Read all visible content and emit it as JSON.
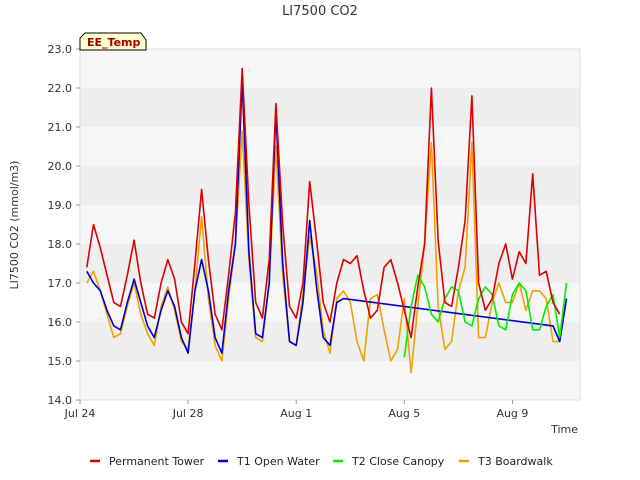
{
  "chart_data": {
    "type": "line",
    "title": "LI7500 CO2",
    "xlabel": "Time",
    "ylabel": "LI7500 CO2 (mmol/m3)",
    "badge": "EE_Temp",
    "xlim": [
      "2023-07-24",
      "2023-08-11T12:00"
    ],
    "ylim": [
      14.0,
      23.0
    ],
    "yticks": [
      "14.0",
      "15.0",
      "16.0",
      "17.0",
      "18.0",
      "19.0",
      "20.0",
      "21.0",
      "22.0",
      "23.0"
    ],
    "xticks": [
      {
        "date": "2023-07-24",
        "label": "Jul 24"
      },
      {
        "date": "2023-07-28",
        "label": "Jul 28"
      },
      {
        "date": "2023-08-01",
        "label": "Aug 1"
      },
      {
        "date": "2023-08-05",
        "label": "Aug 5"
      },
      {
        "date": "2023-08-09",
        "label": "Aug 9"
      }
    ],
    "grid": "horizontal bands",
    "legend_position": "bottom",
    "series": [
      {
        "name": "Permanent Tower",
        "color": "#dd0000",
        "points": [
          [
            "2023-07-24T06:00",
            17.4
          ],
          [
            "2023-07-24T12:00",
            18.5
          ],
          [
            "2023-07-24T18:00",
            17.9
          ],
          [
            "2023-07-25T00:00",
            17.2
          ],
          [
            "2023-07-25T06:00",
            16.5
          ],
          [
            "2023-07-25T12:00",
            16.4
          ],
          [
            "2023-07-25T18:00",
            17.2
          ],
          [
            "2023-07-26T00:00",
            18.1
          ],
          [
            "2023-07-26T06:00",
            17.0
          ],
          [
            "2023-07-26T12:00",
            16.2
          ],
          [
            "2023-07-26T18:00",
            16.1
          ],
          [
            "2023-07-27T00:00",
            17.0
          ],
          [
            "2023-07-27T06:00",
            17.6
          ],
          [
            "2023-07-27T12:00",
            17.1
          ],
          [
            "2023-07-27T18:00",
            16.0
          ],
          [
            "2023-07-28T00:00",
            15.7
          ],
          [
            "2023-07-28T06:00",
            17.5
          ],
          [
            "2023-07-28T12:00",
            19.4
          ],
          [
            "2023-07-28T18:00",
            17.6
          ],
          [
            "2023-07-29T00:00",
            16.2
          ],
          [
            "2023-07-29T06:00",
            15.8
          ],
          [
            "2023-07-29T12:00",
            17.2
          ],
          [
            "2023-07-29T18:00",
            18.8
          ],
          [
            "2023-07-30T00:00",
            22.5
          ],
          [
            "2023-07-30T06:00",
            19.0
          ],
          [
            "2023-07-30T12:00",
            16.5
          ],
          [
            "2023-07-30T18:00",
            16.1
          ],
          [
            "2023-07-31T00:00",
            17.6
          ],
          [
            "2023-07-31T06:00",
            21.6
          ],
          [
            "2023-07-31T12:00",
            18.5
          ],
          [
            "2023-07-31T18:00",
            16.4
          ],
          [
            "2023-08-01T00:00",
            16.1
          ],
          [
            "2023-08-01T06:00",
            17.0
          ],
          [
            "2023-08-01T12:00",
            19.6
          ],
          [
            "2023-08-01T18:00",
            18.1
          ],
          [
            "2023-08-02T00:00",
            16.5
          ],
          [
            "2023-08-02T06:00",
            16.0
          ],
          [
            "2023-08-02T12:00",
            17.0
          ],
          [
            "2023-08-02T18:00",
            17.6
          ],
          [
            "2023-08-03T00:00",
            17.5
          ],
          [
            "2023-08-03T06:00",
            17.7
          ],
          [
            "2023-08-03T12:00",
            16.8
          ],
          [
            "2023-08-03T18:00",
            16.1
          ],
          [
            "2023-08-04T00:00",
            16.3
          ],
          [
            "2023-08-04T06:00",
            17.4
          ],
          [
            "2023-08-04T12:00",
            17.6
          ],
          [
            "2023-08-04T18:00",
            17.0
          ],
          [
            "2023-08-05T00:00",
            16.3
          ],
          [
            "2023-08-05T06:00",
            15.6
          ],
          [
            "2023-08-05T12:00",
            16.9
          ],
          [
            "2023-08-05T18:00",
            18.0
          ],
          [
            "2023-08-06T00:00",
            22.0
          ],
          [
            "2023-08-06T06:00",
            18.1
          ],
          [
            "2023-08-06T12:00",
            16.5
          ],
          [
            "2023-08-06T18:00",
            16.4
          ],
          [
            "2023-08-07T00:00",
            17.4
          ],
          [
            "2023-08-07T06:00",
            18.6
          ],
          [
            "2023-08-07T12:00",
            21.8
          ],
          [
            "2023-08-07T18:00",
            17.0
          ],
          [
            "2023-08-08T00:00",
            16.3
          ],
          [
            "2023-08-08T06:00",
            16.6
          ],
          [
            "2023-08-08T12:00",
            17.5
          ],
          [
            "2023-08-08T18:00",
            18.0
          ],
          [
            "2023-08-09T00:00",
            17.1
          ],
          [
            "2023-08-09T06:00",
            17.8
          ],
          [
            "2023-08-09T12:00",
            17.5
          ],
          [
            "2023-08-09T18:00",
            19.8
          ],
          [
            "2023-08-10T00:00",
            17.2
          ],
          [
            "2023-08-10T06:00",
            17.3
          ],
          [
            "2023-08-10T12:00",
            16.5
          ],
          [
            "2023-08-10T18:00",
            16.2
          ]
        ]
      },
      {
        "name": "T1 Open Water",
        "color": "#0000cc",
        "points": [
          [
            "2023-07-24T06:00",
            17.3
          ],
          [
            "2023-07-24T12:00",
            17.0
          ],
          [
            "2023-07-24T18:00",
            16.8
          ],
          [
            "2023-07-25T00:00",
            16.3
          ],
          [
            "2023-07-25T06:00",
            15.9
          ],
          [
            "2023-07-25T12:00",
            15.8
          ],
          [
            "2023-07-25T18:00",
            16.5
          ],
          [
            "2023-07-26T00:00",
            17.1
          ],
          [
            "2023-07-26T06:00",
            16.5
          ],
          [
            "2023-07-26T12:00",
            15.9
          ],
          [
            "2023-07-26T18:00",
            15.6
          ],
          [
            "2023-07-27T00:00",
            16.3
          ],
          [
            "2023-07-27T06:00",
            16.8
          ],
          [
            "2023-07-27T12:00",
            16.4
          ],
          [
            "2023-07-27T18:00",
            15.6
          ],
          [
            "2023-07-28T00:00",
            15.2
          ],
          [
            "2023-07-28T06:00",
            16.8
          ],
          [
            "2023-07-28T12:00",
            17.6
          ],
          [
            "2023-07-28T18:00",
            16.8
          ],
          [
            "2023-07-29T00:00",
            15.6
          ],
          [
            "2023-07-29T06:00",
            15.2
          ],
          [
            "2023-07-29T12:00",
            16.8
          ],
          [
            "2023-07-29T18:00",
            18.0
          ],
          [
            "2023-07-30T00:00",
            22.2
          ],
          [
            "2023-07-30T06:00",
            17.8
          ],
          [
            "2023-07-30T12:00",
            15.7
          ],
          [
            "2023-07-30T18:00",
            15.6
          ],
          [
            "2023-07-31T00:00",
            17.0
          ],
          [
            "2023-07-31T06:00",
            21.4
          ],
          [
            "2023-07-31T12:00",
            17.5
          ],
          [
            "2023-07-31T18:00",
            15.5
          ],
          [
            "2023-08-01T00:00",
            15.4
          ],
          [
            "2023-08-01T06:00",
            16.5
          ],
          [
            "2023-08-01T12:00",
            18.6
          ],
          [
            "2023-08-01T18:00",
            16.9
          ],
          [
            "2023-08-02T00:00",
            15.6
          ],
          [
            "2023-08-02T06:00",
            15.4
          ],
          [
            "2023-08-02T12:00",
            16.5
          ],
          [
            "2023-08-02T18:00",
            16.6
          ],
          [
            "2023-08-10T12:00",
            15.9
          ],
          [
            "2023-08-10T18:00",
            15.5
          ],
          [
            "2023-08-11T00:00",
            16.6
          ]
        ]
      },
      {
        "name": "T2 Close Canopy",
        "color": "#00ee00",
        "points": [
          [
            "2023-08-05T00:00",
            15.1
          ],
          [
            "2023-08-05T06:00",
            16.4
          ],
          [
            "2023-08-05T12:00",
            17.2
          ],
          [
            "2023-08-05T18:00",
            16.9
          ],
          [
            "2023-08-06T00:00",
            16.2
          ],
          [
            "2023-08-06T06:00",
            16.0
          ],
          [
            "2023-08-06T12:00",
            16.6
          ],
          [
            "2023-08-06T18:00",
            16.9
          ],
          [
            "2023-08-07T00:00",
            16.8
          ],
          [
            "2023-08-07T06:00",
            16.0
          ],
          [
            "2023-08-07T12:00",
            15.9
          ],
          [
            "2023-08-07T18:00",
            16.6
          ],
          [
            "2023-08-08T00:00",
            16.9
          ],
          [
            "2023-08-08T06:00",
            16.7
          ],
          [
            "2023-08-08T12:00",
            15.9
          ],
          [
            "2023-08-08T18:00",
            15.8
          ],
          [
            "2023-08-09T00:00",
            16.7
          ],
          [
            "2023-08-09T06:00",
            17.0
          ],
          [
            "2023-08-09T12:00",
            16.8
          ],
          [
            "2023-08-09T18:00",
            15.8
          ],
          [
            "2023-08-10T00:00",
            15.8
          ],
          [
            "2023-08-10T06:00",
            16.4
          ],
          [
            "2023-08-10T12:00",
            16.7
          ],
          [
            "2023-08-10T18:00",
            15.6
          ],
          [
            "2023-08-11T00:00",
            17.0
          ]
        ]
      },
      {
        "name": "T3 Boardwalk",
        "color": "#f0a000",
        "points": [
          [
            "2023-07-24T06:00",
            17.0
          ],
          [
            "2023-07-24T12:00",
            17.3
          ],
          [
            "2023-07-24T18:00",
            16.8
          ],
          [
            "2023-07-25T00:00",
            16.2
          ],
          [
            "2023-07-25T06:00",
            15.6
          ],
          [
            "2023-07-25T12:00",
            15.7
          ],
          [
            "2023-07-25T18:00",
            16.4
          ],
          [
            "2023-07-26T00:00",
            17.0
          ],
          [
            "2023-07-26T06:00",
            16.2
          ],
          [
            "2023-07-26T12:00",
            15.7
          ],
          [
            "2023-07-26T18:00",
            15.4
          ],
          [
            "2023-07-27T00:00",
            16.4
          ],
          [
            "2023-07-27T06:00",
            16.9
          ],
          [
            "2023-07-27T12:00",
            16.3
          ],
          [
            "2023-07-27T18:00",
            15.5
          ],
          [
            "2023-07-28T00:00",
            15.3
          ],
          [
            "2023-07-28T06:00",
            16.8
          ],
          [
            "2023-07-28T12:00",
            18.7
          ],
          [
            "2023-07-28T18:00",
            16.6
          ],
          [
            "2023-07-29T00:00",
            15.4
          ],
          [
            "2023-07-29T06:00",
            15.0
          ],
          [
            "2023-07-29T12:00",
            16.6
          ],
          [
            "2023-07-29T18:00",
            18.0
          ],
          [
            "2023-07-30T00:00",
            20.9
          ],
          [
            "2023-07-30T06:00",
            17.6
          ],
          [
            "2023-07-30T12:00",
            15.6
          ],
          [
            "2023-07-30T18:00",
            15.5
          ],
          [
            "2023-07-31T00:00",
            17.0
          ],
          [
            "2023-07-31T06:00",
            20.5
          ],
          [
            "2023-07-31T12:00",
            17.2
          ],
          [
            "2023-07-31T18:00",
            15.5
          ],
          [
            "2023-08-01T00:00",
            15.4
          ],
          [
            "2023-08-01T06:00",
            16.7
          ],
          [
            "2023-08-01T12:00",
            18.2
          ],
          [
            "2023-08-01T18:00",
            17.3
          ],
          [
            "2023-08-02T00:00",
            15.8
          ],
          [
            "2023-08-02T06:00",
            15.2
          ],
          [
            "2023-08-02T12:00",
            16.6
          ],
          [
            "2023-08-02T18:00",
            16.8
          ],
          [
            "2023-08-03T00:00",
            16.5
          ],
          [
            "2023-08-03T06:00",
            15.5
          ],
          [
            "2023-08-03T12:00",
            15.0
          ],
          [
            "2023-08-03T18:00",
            16.6
          ],
          [
            "2023-08-04T00:00",
            16.7
          ],
          [
            "2023-08-04T06:00",
            15.8
          ],
          [
            "2023-08-04T12:00",
            15.0
          ],
          [
            "2023-08-04T18:00",
            15.3
          ],
          [
            "2023-08-05T00:00",
            16.6
          ],
          [
            "2023-08-05T06:00",
            14.7
          ],
          [
            "2023-08-05T12:00",
            16.4
          ],
          [
            "2023-08-05T18:00",
            18.0
          ],
          [
            "2023-08-06T00:00",
            20.6
          ],
          [
            "2023-08-06T06:00",
            16.4
          ],
          [
            "2023-08-06T12:00",
            15.3
          ],
          [
            "2023-08-06T18:00",
            15.5
          ],
          [
            "2023-08-07T00:00",
            16.8
          ],
          [
            "2023-08-07T06:00",
            17.4
          ],
          [
            "2023-08-07T12:00",
            20.6
          ],
          [
            "2023-08-07T18:00",
            15.6
          ],
          [
            "2023-08-08T00:00",
            15.6
          ],
          [
            "2023-08-08T06:00",
            16.5
          ],
          [
            "2023-08-08T12:00",
            17.0
          ],
          [
            "2023-08-08T18:00",
            16.5
          ],
          [
            "2023-08-09T00:00",
            16.5
          ],
          [
            "2023-08-09T06:00",
            17.0
          ],
          [
            "2023-08-09T12:00",
            16.3
          ],
          [
            "2023-08-09T18:00",
            16.8
          ],
          [
            "2023-08-10T00:00",
            16.8
          ],
          [
            "2023-08-10T06:00",
            16.6
          ],
          [
            "2023-08-10T12:00",
            15.5
          ],
          [
            "2023-08-10T18:00",
            15.5
          ],
          [
            "2023-08-11T00:00",
            16.6
          ]
        ]
      }
    ]
  }
}
